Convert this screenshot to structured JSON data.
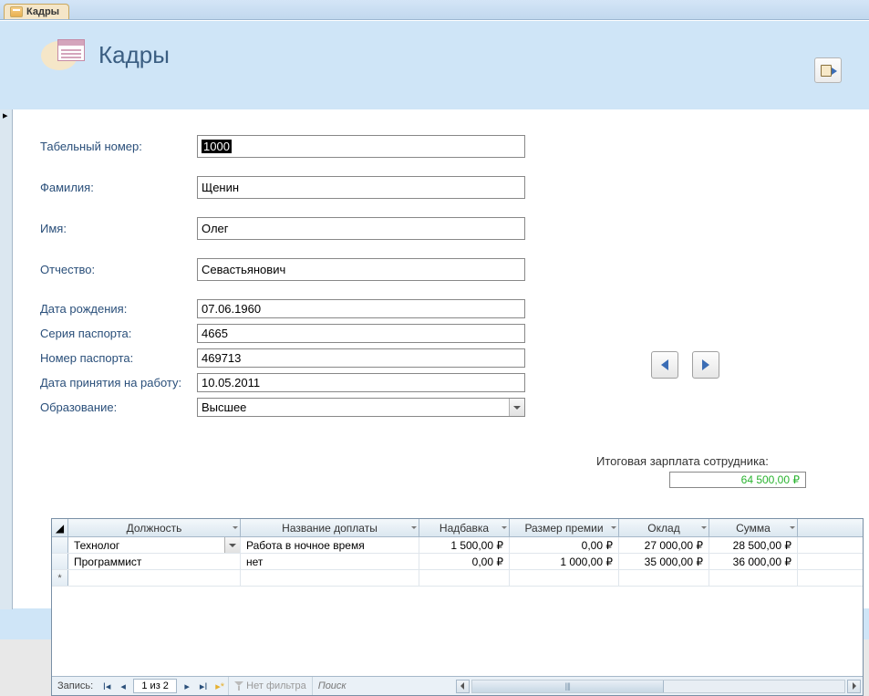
{
  "tab": {
    "label": "Кадры"
  },
  "header": {
    "title": "Кадры"
  },
  "fields": {
    "emp_no_label": "Табельный номер:",
    "emp_no": "1000",
    "lastname_label": "Фамилия:",
    "lastname": "Щенин",
    "firstname_label": "Имя:",
    "firstname": "Олег",
    "patronymic_label": "Отчество:",
    "patronymic": "Севастьянович",
    "dob_label": "Дата рождения:",
    "dob": "07.06.1960",
    "passport_series_label": "Серия паспорта:",
    "passport_series": "4665",
    "passport_no_label": "Номер паспорта:",
    "passport_no": "469713",
    "hire_date_label": "Дата принятия на работу:",
    "hire_date": "10.05.2011",
    "education_label": "Образование:",
    "education": "Высшее"
  },
  "salary": {
    "label": "Итоговая зарплата сотрудника:",
    "value": "64 500,00 ₽"
  },
  "subform": {
    "columns": {
      "c1": "Должность",
      "c2": "Название доплаты",
      "c3": "Надбавка",
      "c4": "Размер премии",
      "c5": "Оклад",
      "c6": "Сумма"
    },
    "rows": [
      {
        "c1": "Технолог",
        "c2": "Работа в ночное время",
        "c3": "1 500,00 ₽",
        "c4": "0,00 ₽",
        "c5": "27 000,00 ₽",
        "c6": "28 500,00 ₽"
      },
      {
        "c1": "Программист",
        "c2": "нет",
        "c3": "0,00 ₽",
        "c4": "1 000,00 ₽",
        "c5": "35 000,00 ₽",
        "c6": "36 000,00 ₽"
      }
    ],
    "nav": {
      "label": "Запись:",
      "position": "1 из 2",
      "no_filter": "Нет фильтра",
      "search": "Поиск"
    }
  }
}
